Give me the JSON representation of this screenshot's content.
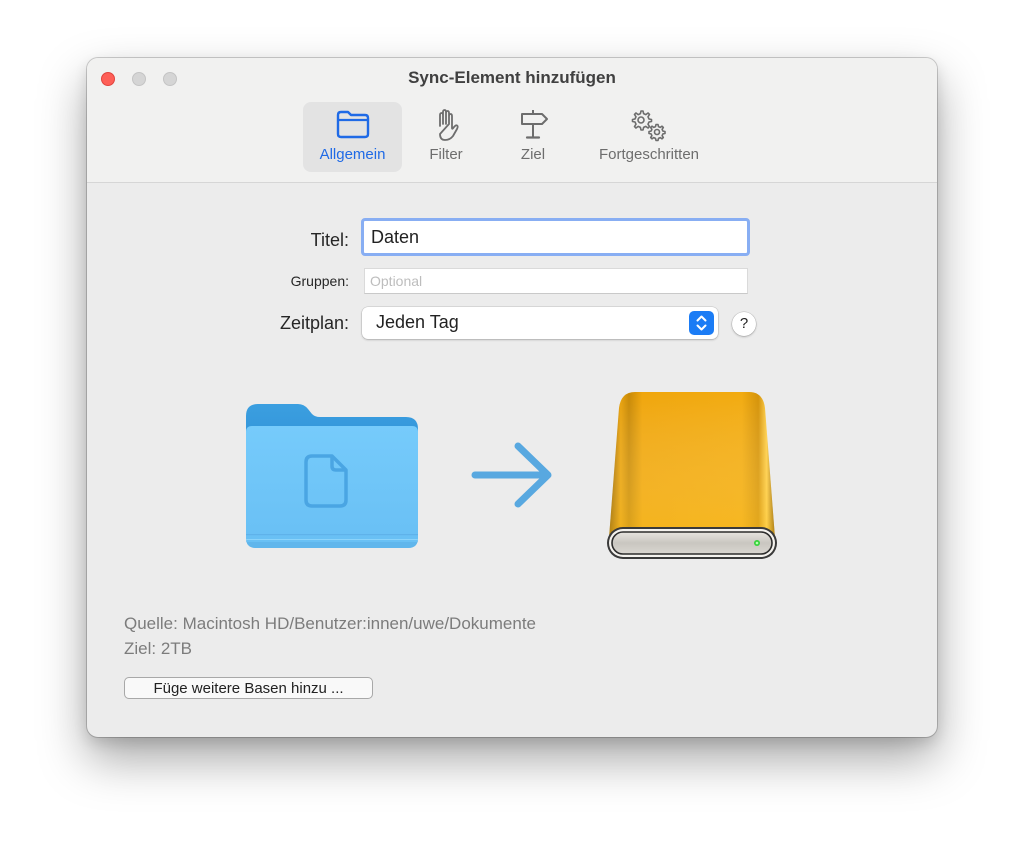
{
  "window": {
    "title": "Sync-Element hinzufügen",
    "controls": [
      "close",
      "minimize",
      "maximize"
    ]
  },
  "toolbar": {
    "tabs": [
      {
        "label": "Allgemein",
        "icon": "folder-icon",
        "selected": true
      },
      {
        "label": "Filter",
        "icon": "hand-icon",
        "selected": false
      },
      {
        "label": "Ziel",
        "icon": "signpost-icon",
        "selected": false
      },
      {
        "label": "Fortgeschritten",
        "icon": "gears-icon",
        "selected": false
      }
    ]
  },
  "form": {
    "title_label": "Titel:",
    "title_value": "Daten",
    "groups_label": "Gruppen:",
    "groups_value": "",
    "groups_placeholder": "Optional",
    "schedule_label": "Zeitplan:",
    "schedule_value": "Jeden Tag",
    "help_label": "?"
  },
  "sync_visual": {
    "source_icon": "documents-folder-icon",
    "direction_icon": "arrow-right-icon",
    "destination_icon": "external-drive-icon"
  },
  "info": {
    "source": "Quelle: Macintosh HD/Benutzer:innen/uwe/Dokumente",
    "destination": "Ziel: 2TB"
  },
  "actions": {
    "add_bases_label": "Füge weitere Basen hinzu ..."
  },
  "colors": {
    "accent": "#1f6ae6",
    "focus_ring": "#88aef3",
    "close": "#fe5f57",
    "folder": "#6cc5f9",
    "drive": "#f0a30a",
    "arrow": "#58a8e0"
  }
}
